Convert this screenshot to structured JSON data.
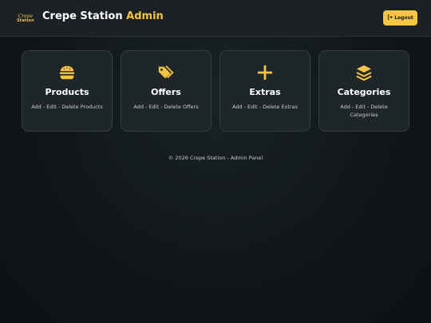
{
  "header": {
    "logo_line1": "Crepe",
    "logo_line2": "Station",
    "title_main": "Crepe Station",
    "title_accent": "Admin",
    "logout_label": "Logout"
  },
  "cards": [
    {
      "title": "Products",
      "description": "Add - Edit - Delete Products",
      "icon": "burger-icon"
    },
    {
      "title": "Offers",
      "description": "Add - Edit - Delete Offers",
      "icon": "tags-icon"
    },
    {
      "title": "Extras",
      "description": "Add - Edit - Delete Extras",
      "icon": "plus-icon"
    },
    {
      "title": "Categories",
      "description": "Add - Edit - Delete Categories",
      "icon": "layers-icon"
    }
  ],
  "footer": {
    "text": "© 2026 Crepe Station - Admin Panel"
  },
  "colors": {
    "accent": "#f4c542",
    "header_bg": "#1b2124",
    "card_bg": "#1f2629",
    "page_bg": "#111719"
  }
}
